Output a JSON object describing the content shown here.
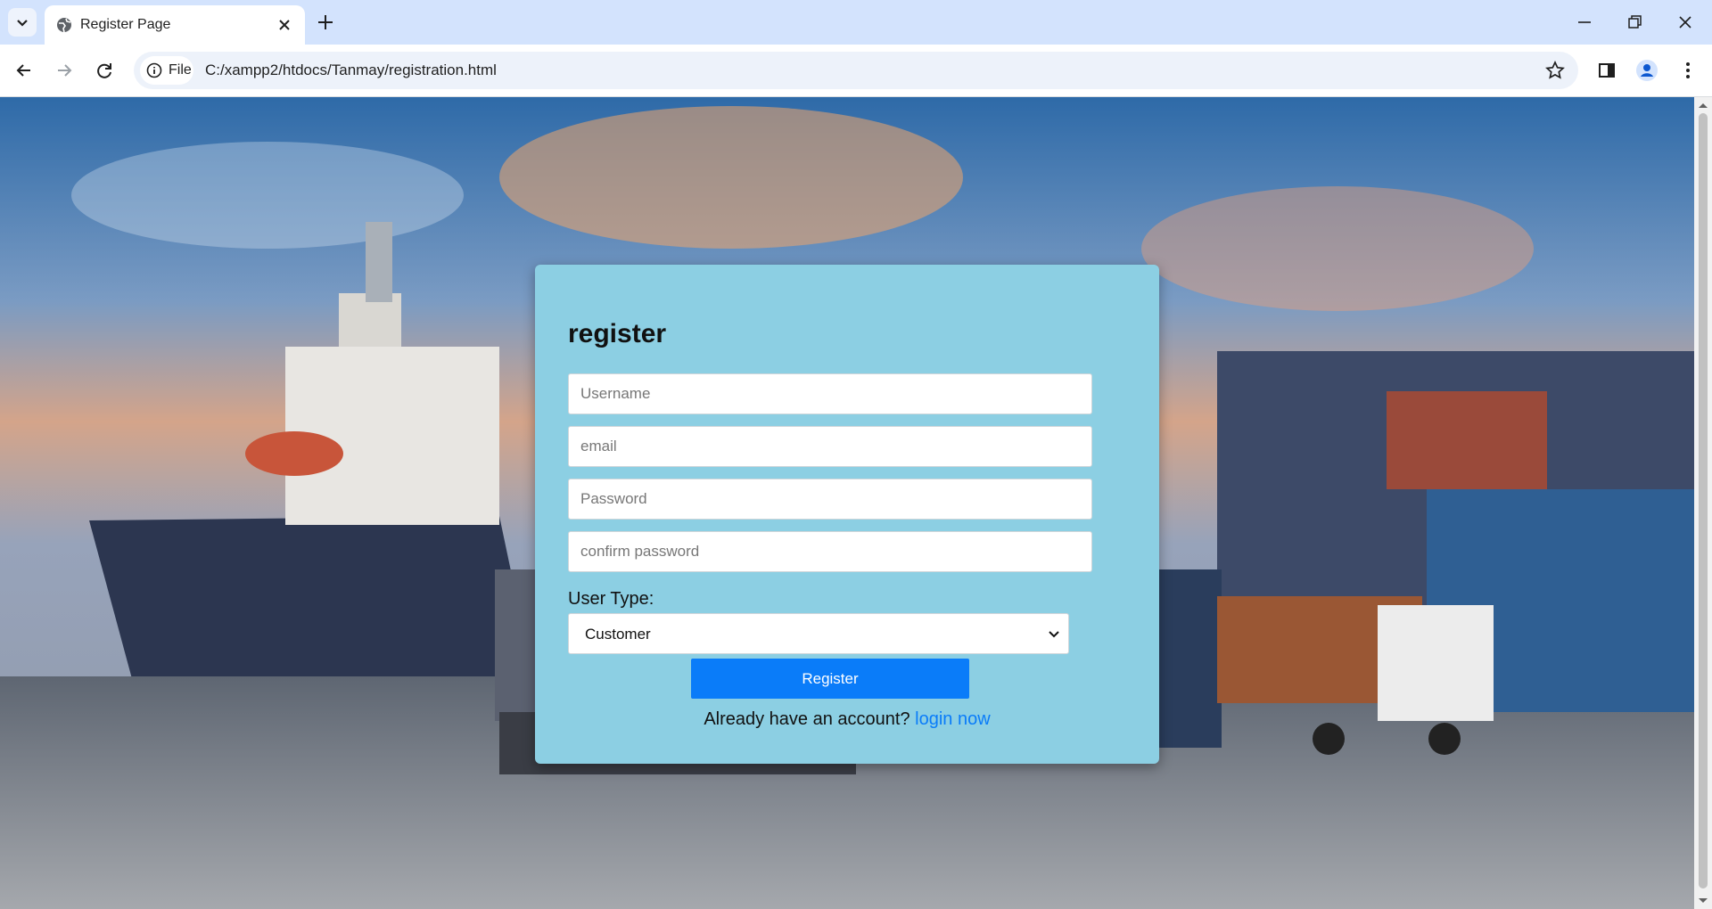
{
  "browser": {
    "tab_title": "Register Page",
    "site_chip_label": "File",
    "url": "C:/xampp2/htdocs/Tanmay/registration.html",
    "icons": [
      "tab-list-icon",
      "globe-icon",
      "close-icon",
      "plus-icon",
      "minimize-icon",
      "restore-icon",
      "window-close-icon",
      "back-icon",
      "forward-icon",
      "reload-icon",
      "info-icon",
      "star-icon",
      "side-panel-icon",
      "profile-icon",
      "menu-icon"
    ]
  },
  "form": {
    "title": "register",
    "username_placeholder": "Username",
    "email_placeholder": "email",
    "password_placeholder": "Password",
    "confirm_placeholder": "confirm password",
    "user_type_label": "User Type:",
    "user_type_value": "Customer",
    "register_label": "Register",
    "login_prompt": "Already have an account?",
    "login_link": "login now"
  },
  "colors": {
    "card": "#8ccfe3",
    "button": "#0a7cf9",
    "link": "#0a7cf9"
  }
}
